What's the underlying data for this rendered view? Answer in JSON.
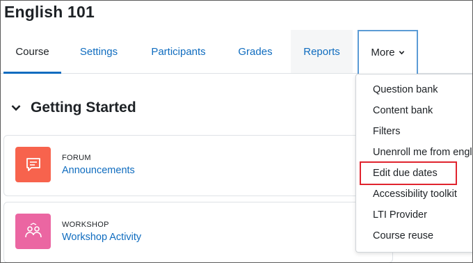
{
  "course": {
    "title": "English 101"
  },
  "nav": {
    "tabs": [
      {
        "label": "Course"
      },
      {
        "label": "Settings"
      },
      {
        "label": "Participants"
      },
      {
        "label": "Grades"
      },
      {
        "label": "Reports"
      },
      {
        "label": "More"
      }
    ]
  },
  "section": {
    "title": "Getting Started"
  },
  "activities": [
    {
      "type": "FORUM",
      "name": "Announcements",
      "color": "#f7634d"
    },
    {
      "type": "WORKSHOP",
      "name": "Workshop Activity",
      "color": "#eb66a2"
    }
  ],
  "more_menu": {
    "items": [
      {
        "label": "Question bank"
      },
      {
        "label": "Content bank"
      },
      {
        "label": "Filters"
      },
      {
        "label": "Unenroll me from engl"
      },
      {
        "label": "Edit due dates"
      },
      {
        "label": "Accessibility toolkit"
      },
      {
        "label": "LTI Provider"
      },
      {
        "label": "Course reuse"
      }
    ]
  },
  "colors": {
    "link": "#0f6cbf",
    "highlight": "#e0232e",
    "active_underline": "#0f6cbf"
  }
}
